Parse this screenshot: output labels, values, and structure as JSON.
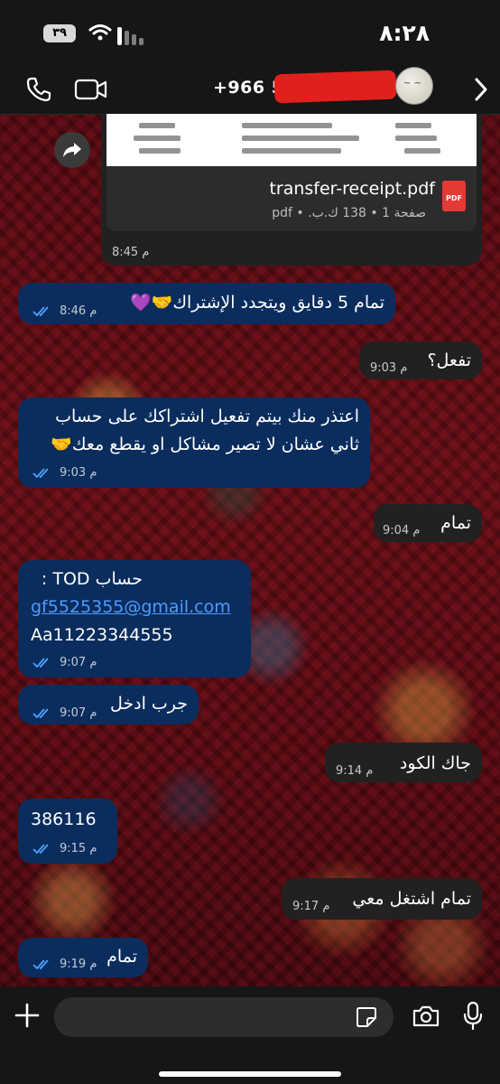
{
  "status_bar": {
    "time": "٨:٢٨",
    "battery": "٣٩"
  },
  "header": {
    "contact_number": "+966 55 7"
  },
  "pdf_message": {
    "file_name": "transfer-receipt.pdf",
    "file_meta": "صفحة 1 • 138 ك.ب. • pdf",
    "icon_label": "PDF",
    "time": "8:45 م"
  },
  "messages": [
    {
      "text": "تمام 5 دقايق ويتجدد الإشتراك🤝💜",
      "time": "8:46 م"
    },
    {
      "text": "تفعل؟",
      "time": "9:03 م"
    },
    {
      "line1": "اعتذر منك بيتم تفعيل اشتراكك على حساب",
      "line2": "ثاني عشان لا تصير مشاكل او يقطع معك🤝",
      "time": "9:03 م"
    },
    {
      "text": "تمام",
      "time": "9:04 م"
    },
    {
      "line1": "حساب  TOD :",
      "email": "gf5525355@gmail.com",
      "password": "Aa11223344555",
      "time": "9:07 م"
    },
    {
      "text": "جرب ادخل",
      "time": "9:07 م"
    },
    {
      "text": "جاك الكود",
      "time": "9:14 م"
    },
    {
      "text": "386116",
      "time": "9:15 م"
    },
    {
      "text": "تمام اشتغل معي",
      "time": "9:17 م"
    },
    {
      "text": "تمام",
      "time": "9:19 م"
    }
  ],
  "icons": {
    "header": [
      "phone-icon",
      "video-icon",
      "chevron-right-icon"
    ],
    "bottom": [
      "plus-icon",
      "sticker-icon",
      "camera-icon",
      "mic-icon"
    ]
  },
  "colors": {
    "outgoing_bubble": "#0a2d5e",
    "incoming_bubble": "#212121",
    "read_ticks": "#4fa3ff",
    "pdf_icon": "#e53935"
  }
}
